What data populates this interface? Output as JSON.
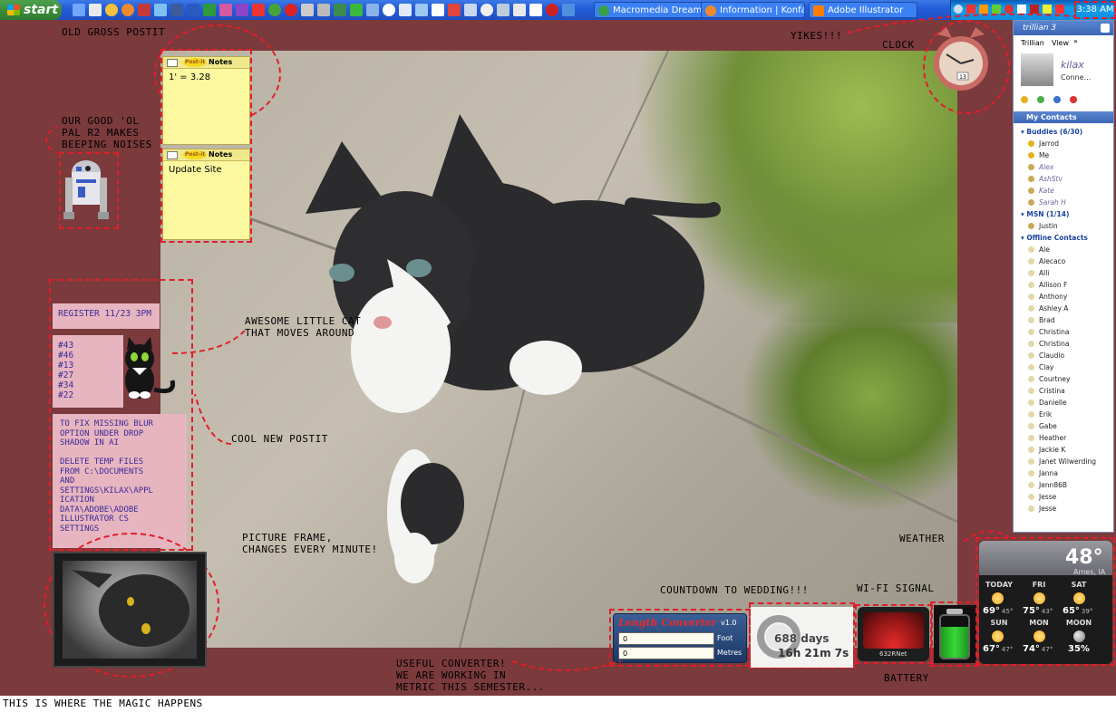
{
  "taskbar": {
    "start_label": "start",
    "tasks": [
      {
        "label": "Macromedia Dreamw...",
        "icon": "dreamweaver-icon"
      },
      {
        "label": "Information | Konfab...",
        "icon": "firefox-icon"
      },
      {
        "label": "Adobe Illustrator",
        "icon": "illustrator-icon"
      }
    ],
    "clock": "3:38 AM"
  },
  "annotations": {
    "old_postit": "Old gross postit",
    "r2": "Our good 'ol\npal R2 makes\nbeeping noises",
    "cat": "Awesome little cat\nthat moves around",
    "new_postit": "Cool new postit",
    "frame": "Picture frame,\nchanges every minute!",
    "converter": "Useful converter!\nWe are working in\nmetric this semester...",
    "countdown": "Countdown to wedding!!!",
    "wifi": "Wi-Fi signal",
    "battery": "Battery",
    "weather": "Weather",
    "yikes": "Yikes!!!",
    "clock": "Clock",
    "footer": "This is where the magic happens"
  },
  "postits": [
    {
      "title": "Notes",
      "logo": "Post-it",
      "text": "1' = 3.28"
    },
    {
      "title": "Notes",
      "logo": "Post-it",
      "text": "Update Site"
    }
  ],
  "pink_notes": {
    "register": "Register 11/23 3PM",
    "numbers": "#43\n#46\n#13\n#27\n#34\n#22",
    "blur_fix": "To fix missing blur\noption under drop\nshadow in AI\n\nDelete temp files\nfrom C:\\Documents\nand\nSettings\\kilax\\Appl\nication\nData\\Adobe\\Adobe\nIllustrator CS\nSettings"
  },
  "trillian": {
    "brand": "trillian 3",
    "menu": [
      "Trillian",
      "View",
      "»"
    ],
    "username": "kilax",
    "status": "Conne...",
    "contacts_title": "My Contacts",
    "groups": [
      {
        "name": "Buddies (6/30)",
        "members": [
          {
            "name": "Jarrod",
            "state": "online"
          },
          {
            "name": "Me",
            "state": "online"
          },
          {
            "name": "Alex",
            "state": "offline-aim"
          },
          {
            "name": "AshStv",
            "state": "offline-aim"
          },
          {
            "name": "Kate",
            "state": "offline-aim"
          },
          {
            "name": "Sarah H",
            "state": "offline-aim"
          }
        ]
      },
      {
        "name": "MSN (1/14)",
        "members": [
          {
            "name": "Justin",
            "state": "online-aim"
          }
        ]
      },
      {
        "name": "Offline Contacts",
        "members": [
          {
            "name": "Ale"
          },
          {
            "name": "Alecaco"
          },
          {
            "name": "Alli"
          },
          {
            "name": "Allison F"
          },
          {
            "name": "Anthony"
          },
          {
            "name": "Ashley A"
          },
          {
            "name": "Brad"
          },
          {
            "name": "Christina"
          },
          {
            "name": "Christina"
          },
          {
            "name": "Claudio"
          },
          {
            "name": "Clay"
          },
          {
            "name": "Courtney"
          },
          {
            "name": "Cristina"
          },
          {
            "name": "Danielle"
          },
          {
            "name": "Erik"
          },
          {
            "name": "Gabe"
          },
          {
            "name": "Heather"
          },
          {
            "name": "Jackie K"
          },
          {
            "name": "Janet Wilwerding"
          },
          {
            "name": "Janna"
          },
          {
            "name": "Jenn86B"
          },
          {
            "name": "Jesse"
          },
          {
            "name": "Jesse"
          }
        ]
      }
    ]
  },
  "converter": {
    "title": "Length Converter",
    "version": "v1.0",
    "foot_value": "0",
    "foot_label": "Foot",
    "metres_value": "0",
    "metres_label": "Metres"
  },
  "countdown": {
    "days": "688 days",
    "time": "16h 21m 7s"
  },
  "wifi": {
    "network": "632RNet"
  },
  "battery": {
    "level": 0.75,
    "color": "#3ad63a"
  },
  "weather": {
    "temp": "48°",
    "location": "Ames, IA",
    "days": [
      {
        "label": "TODAY",
        "hi": "69°",
        "lo": "45°"
      },
      {
        "label": "FRI",
        "hi": "75°",
        "lo": "43°"
      },
      {
        "label": "SAT",
        "hi": "65°",
        "lo": "39°"
      },
      {
        "label": "SUN",
        "hi": "67°",
        "lo": "47°"
      },
      {
        "label": "MON",
        "hi": "74°",
        "lo": "47°"
      },
      {
        "label": "MOON",
        "hi": "35%",
        "lo": ""
      }
    ]
  },
  "clock_widget": {
    "date": "13"
  },
  "colors": {
    "desktop": "#7b3a3c",
    "annotation_dash": "#e01e2a",
    "taskbar": "#245edb"
  }
}
